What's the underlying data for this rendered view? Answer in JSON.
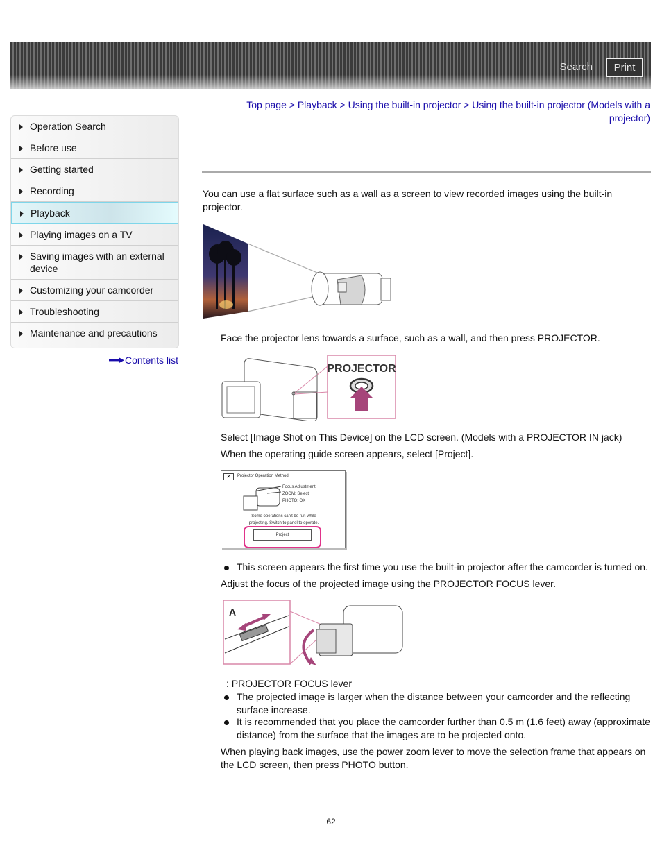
{
  "header": {
    "search_label": "Search",
    "print_label": "Print"
  },
  "sidebar": {
    "items": [
      {
        "label": "Operation Search"
      },
      {
        "label": "Before use"
      },
      {
        "label": "Getting started"
      },
      {
        "label": "Recording"
      },
      {
        "label": "Playback",
        "active": true
      },
      {
        "label": "Playing images on a TV"
      },
      {
        "label": "Saving images with an external device"
      },
      {
        "label": "Customizing your camcorder"
      },
      {
        "label": "Troubleshooting"
      },
      {
        "label": "Maintenance and precautions"
      }
    ],
    "contents_link": "Contents list"
  },
  "breadcrumb": {
    "items": [
      "Top page",
      "Playback",
      "Using the built-in projector",
      "Using the built-in projector (Models with a projector)"
    ],
    "separator": ">"
  },
  "content": {
    "intro": "You can use a flat surface such as a wall as a screen to view recorded images using the built-in projector.",
    "step1": "Face the projector lens towards a surface, such as a wall, and then press PROJECTOR.",
    "projector_button_label": "PROJECTOR",
    "step2a": "Select [Image Shot on This Device] on the LCD screen. (Models with a PROJECTOR IN jack)",
    "step2b": "When the operating guide screen appears, select [Project].",
    "dialog": {
      "title": "Projector Operation Method",
      "close": "✕",
      "line1": "Focus Adjustment",
      "line2": "ZOOM: Select",
      "line3": "PHOTO: OK",
      "note1": "Some operations can't be run while",
      "note2": "projecting. Switch to panel to operate.",
      "button": "Project"
    },
    "note_first_time": "This screen appears the first time you use the built-in projector after the camcorder is turned on.",
    "step3": "Adjust the focus of the projected image using the PROJECTOR FOCUS lever.",
    "focus_label_letter": "A",
    "focus_caption": ": PROJECTOR FOCUS lever",
    "bullets": [
      "The projected image is larger when the distance between your camcorder and the reflecting surface increase.",
      "It is recommended that you place the camcorder further than 0.5 m (1.6 feet) away (approximate distance) from the surface that the images are to be projected onto."
    ],
    "step4": "When playing back images, use the power zoom lever to move the selection frame that appears on the LCD screen, then press PHOTO button."
  },
  "footer": {
    "page_number": "62"
  }
}
